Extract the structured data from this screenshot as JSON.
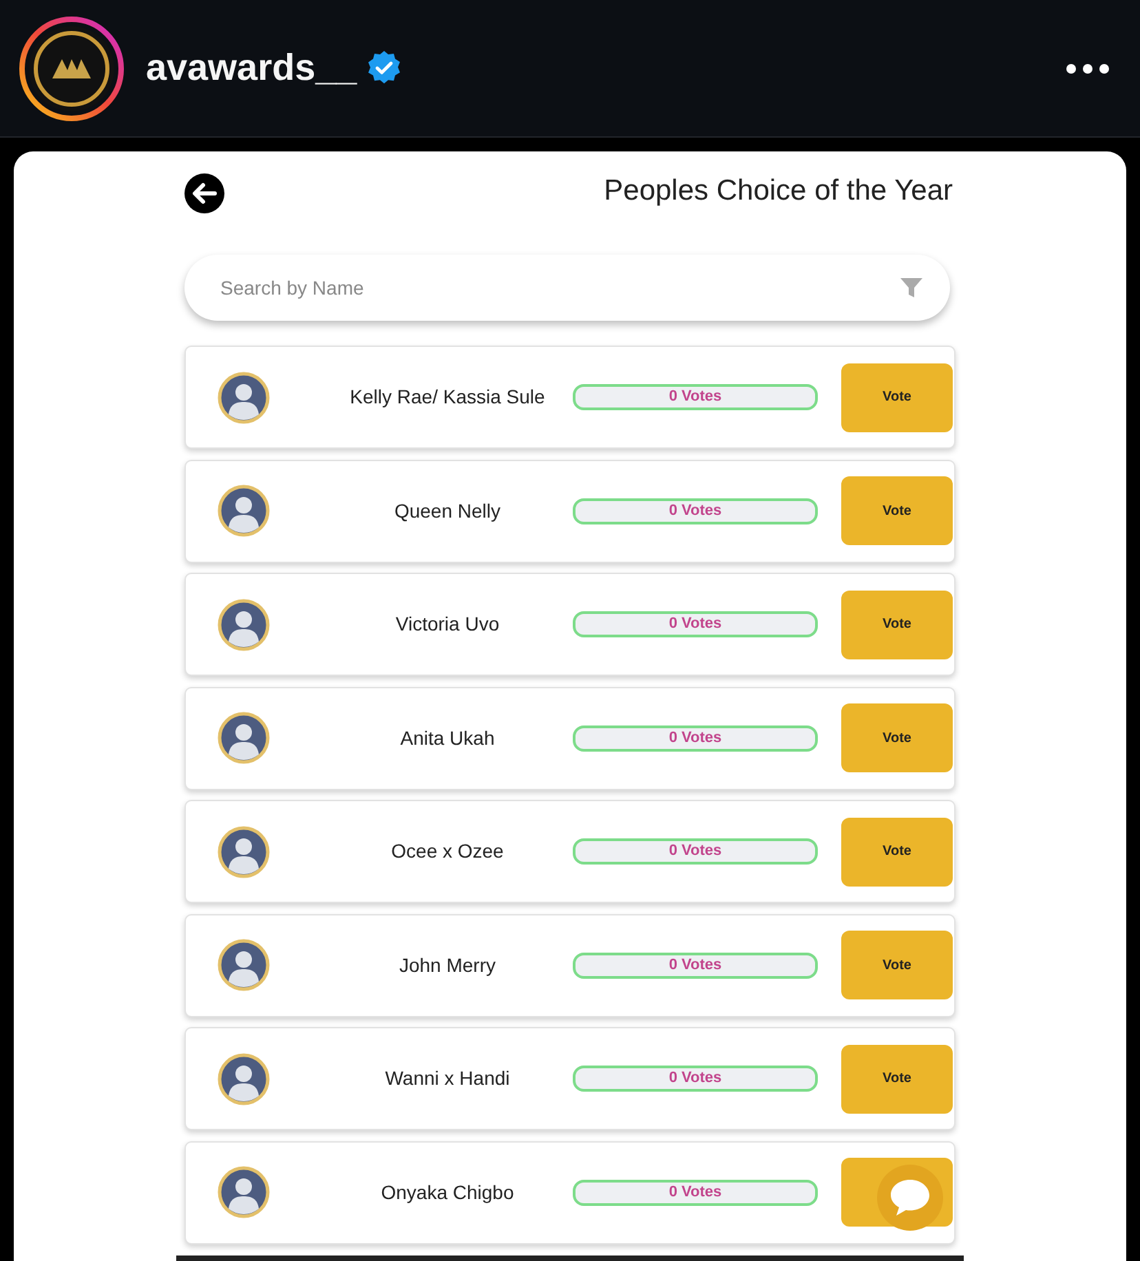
{
  "post_header": {
    "username": "avawards__",
    "verified": true
  },
  "page": {
    "title": "Peoples Choice of the Year",
    "search": {
      "placeholder": "Search by Name"
    }
  },
  "nominees": [
    {
      "name": "Kelly Rae/ Kassia Sule",
      "votes": "0 Votes",
      "level": 0,
      "vote_button": "Vote"
    },
    {
      "name": "Queen Nelly",
      "votes": "0 Votes",
      "level": 0,
      "vote_button": "Vote"
    },
    {
      "name": "Victoria Uvo",
      "votes": "0 Votes",
      "level": 0,
      "vote_button": "Vote"
    },
    {
      "name": "Anita Ukah",
      "votes": "0 Votes",
      "level": 0,
      "vote_button": "Vote"
    },
    {
      "name": "Ocee x Ozee",
      "votes": "0 Votes",
      "level": 0,
      "vote_button": "Vote"
    },
    {
      "name": "John Merry",
      "votes": "0 Votes",
      "level": 0,
      "vote_button": "Vote"
    },
    {
      "name": "Wanni x Handi",
      "votes": "0 Votes",
      "level": 0,
      "vote_button": "Vote"
    },
    {
      "name": "Onyaka Chigbo",
      "votes": "0 Votes",
      "level": 0
    }
  ]
}
